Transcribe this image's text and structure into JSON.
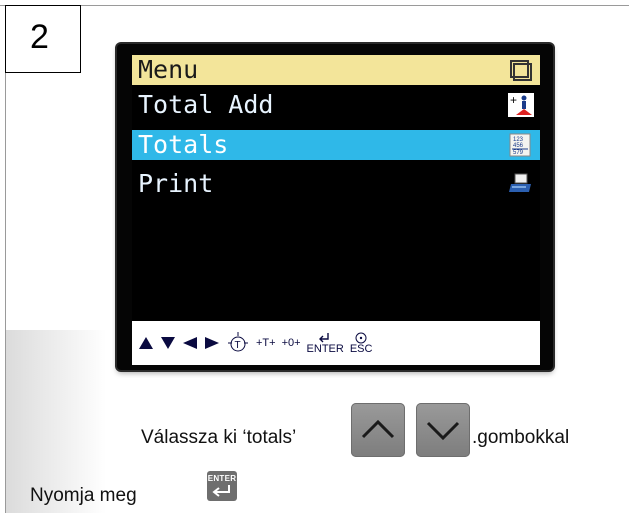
{
  "step": {
    "number": "2"
  },
  "device": {
    "menu_header": "Menu",
    "items": [
      {
        "label": "Total Add",
        "icon": "total-add-icon",
        "selected": false
      },
      {
        "label": "Totals",
        "icon": "totals-icon",
        "selected": true
      },
      {
        "label": "Print",
        "icon": "printer-icon",
        "selected": false
      }
    ],
    "footer": {
      "t_label": "T",
      "plus_t": "+T+",
      "plus_zero": "+0+",
      "enter": "ENTER",
      "esc": "ESC"
    },
    "colors": {
      "header_bg": "#f3e59a",
      "selected_bg": "#2fb8e8",
      "lcd_bg": "#000000"
    }
  },
  "instructions": {
    "line1_prefix": "Válassza ki ‘totals’",
    "line1_suffix": ".gombokkal",
    "line2": "Nyomja meg",
    "enter_key_label": "ENTER"
  }
}
